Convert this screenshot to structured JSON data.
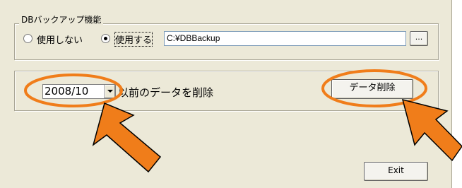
{
  "backup": {
    "group_title": "DBバックアップ機能",
    "option_off": "使用しない",
    "option_on": "使用する",
    "selected": "option_on",
    "path": "C:¥DBBackup",
    "browse_label": "..."
  },
  "delete": {
    "month_value": "2008/10",
    "label": "以前のデータを削除",
    "button_label": "データ削除"
  },
  "exit_label": "Exit",
  "colors": {
    "highlight": "#f07d1a"
  }
}
